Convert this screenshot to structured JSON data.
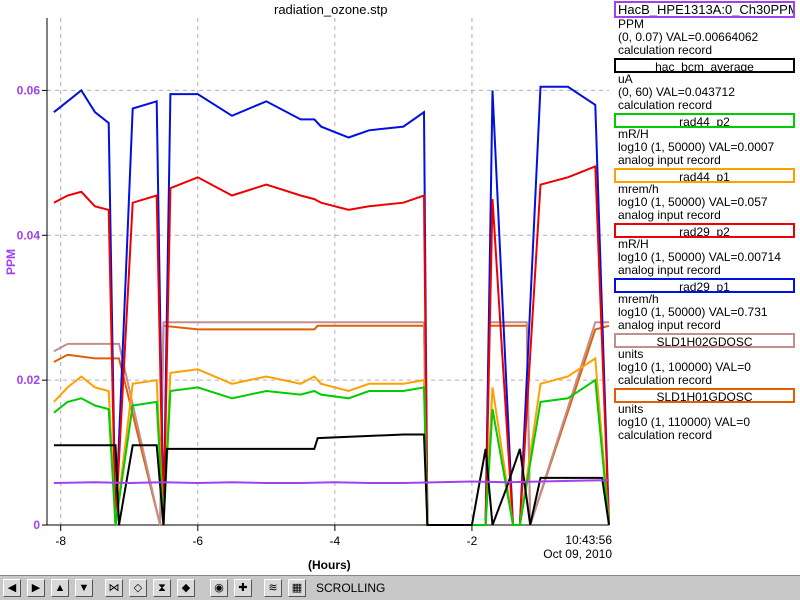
{
  "window": {
    "title": "radiation_ozone.stp",
    "status": "SCROLLING"
  },
  "chart_data": {
    "type": "line",
    "title": "radiation_ozone.stp",
    "xlabel": "(Hours)",
    "ylabel": "PPM",
    "xlim": [
      -8.2,
      0.0
    ],
    "ylim": [
      0.0,
      0.07
    ],
    "xticks": [
      -8,
      -6,
      -4,
      -2
    ],
    "yticks": [
      0,
      0.02,
      0.04,
      0.06
    ],
    "xtick_labels": [
      "-8",
      "-6",
      "-4",
      "-2"
    ],
    "ytick_labels": [
      "0",
      "0.02",
      "0.04",
      "0.06"
    ],
    "grid": true,
    "legend_position": "right",
    "time_label": "10:43:56",
    "date_label": "Oct 09, 2010",
    "series": [
      {
        "name": "HacB_HPE1313A:0_Ch30PPM",
        "color": "#a040f0",
        "x": [
          -8.1,
          -7.5,
          -7.0,
          -6.5,
          -6.0,
          -5.5,
          -5.0,
          -4.5,
          -4.0,
          -3.5,
          -3.0,
          -2.5,
          -2.0,
          -1.5,
          -1.0,
          -0.5,
          0.0
        ],
        "y": [
          0.0058,
          0.0059,
          0.0058,
          0.0059,
          0.0058,
          0.0059,
          0.0058,
          0.0058,
          0.0059,
          0.0058,
          0.0058,
          0.0059,
          0.006,
          0.0059,
          0.006,
          0.0061,
          0.0062
        ]
      },
      {
        "name": "hac_bcm_average",
        "color": "#000000",
        "x": [
          -8.1,
          -8.05,
          -7.2,
          -7.15,
          -6.95,
          -6.6,
          -6.5,
          -6.45,
          -5.5,
          -5.0,
          -4.3,
          -4.25,
          -3.0,
          -2.7,
          -2.65,
          -2.0,
          -1.8,
          -1.7,
          -1.5,
          -1.3,
          -1.15,
          -1.0,
          -0.5,
          -0.1,
          0.0
        ],
        "y": [
          0.011,
          0.011,
          0.011,
          0.0,
          0.011,
          0.011,
          0.0,
          0.0105,
          0.0105,
          0.0105,
          0.0105,
          0.012,
          0.0125,
          0.0125,
          0.0,
          0.0,
          0.0105,
          0.0,
          0.005,
          0.0105,
          0.0,
          0.0065,
          0.0065,
          0.0065,
          0.0
        ]
      },
      {
        "name": "rad44_p2",
        "color": "#00cc00",
        "x": [
          -8.1,
          -7.9,
          -7.7,
          -7.5,
          -7.3,
          -7.2,
          -6.95,
          -6.6,
          -6.5,
          -6.4,
          -6.0,
          -5.5,
          -5.0,
          -4.5,
          -4.3,
          -4.2,
          -3.8,
          -3.5,
          -3.0,
          -2.7,
          -2.65,
          -1.8,
          -1.7,
          -1.4,
          -1.3,
          -1.0,
          -0.6,
          -0.2,
          0.0
        ],
        "y": [
          0.0155,
          0.017,
          0.0175,
          0.0165,
          0.016,
          0.0,
          0.0165,
          0.017,
          0.0,
          0.0185,
          0.019,
          0.0175,
          0.0185,
          0.018,
          0.0185,
          0.018,
          0.0175,
          0.0185,
          0.0185,
          0.019,
          0.0,
          0.0,
          0.016,
          0.0,
          0.0,
          0.017,
          0.0175,
          0.02,
          0.0
        ]
      },
      {
        "name": "rad44_p1",
        "color": "#ffa000",
        "x": [
          -8.1,
          -7.9,
          -7.7,
          -7.5,
          -7.3,
          -7.2,
          -6.95,
          -6.6,
          -6.5,
          -6.4,
          -6.0,
          -5.5,
          -5.0,
          -4.5,
          -4.3,
          -4.2,
          -3.8,
          -3.5,
          -3.0,
          -2.7,
          -2.65,
          -1.8,
          -1.7,
          -1.4,
          -1.3,
          -1.0,
          -0.6,
          -0.2,
          0.0
        ],
        "y": [
          0.017,
          0.019,
          0.0205,
          0.019,
          0.0185,
          0.0,
          0.0195,
          0.02,
          0.0,
          0.021,
          0.0215,
          0.0195,
          0.0205,
          0.0195,
          0.0205,
          0.0195,
          0.0185,
          0.0195,
          0.0195,
          0.02,
          0.0,
          0.0,
          0.019,
          0.0,
          0.0,
          0.0195,
          0.0205,
          0.023,
          0.0
        ]
      },
      {
        "name": "rad29_p2",
        "color": "#ee0000",
        "x": [
          -8.1,
          -7.9,
          -7.7,
          -7.5,
          -7.3,
          -7.2,
          -6.95,
          -6.6,
          -6.5,
          -6.4,
          -6.0,
          -5.5,
          -5.0,
          -4.5,
          -4.3,
          -4.2,
          -3.8,
          -3.5,
          -3.0,
          -2.7,
          -2.65,
          -1.8,
          -1.7,
          -1.4,
          -1.3,
          -1.0,
          -0.6,
          -0.2,
          0.0
        ],
        "y": [
          0.0445,
          0.0455,
          0.046,
          0.044,
          0.0435,
          0.0,
          0.0445,
          0.0455,
          0.0,
          0.0465,
          0.048,
          0.0455,
          0.047,
          0.0455,
          0.045,
          0.0445,
          0.0435,
          0.044,
          0.0445,
          0.0455,
          0.0,
          0.0,
          0.045,
          0.0,
          0.0,
          0.047,
          0.048,
          0.0495,
          0.0
        ]
      },
      {
        "name": "rad29_p1",
        "color": "#0010e0",
        "x": [
          -8.1,
          -7.9,
          -7.7,
          -7.5,
          -7.3,
          -7.2,
          -6.95,
          -6.6,
          -6.5,
          -6.4,
          -6.0,
          -5.5,
          -5.0,
          -4.5,
          -4.3,
          -4.2,
          -3.8,
          -3.5,
          -3.0,
          -2.7,
          -2.65,
          -1.8,
          -1.7,
          -1.4,
          -1.3,
          -1.0,
          -0.6,
          -0.2,
          0.0
        ],
        "y": [
          0.057,
          0.0585,
          0.06,
          0.057,
          0.0555,
          0.0,
          0.0575,
          0.0585,
          0.0,
          0.0595,
          0.0595,
          0.0565,
          0.0585,
          0.056,
          0.056,
          0.055,
          0.0535,
          0.0545,
          0.055,
          0.057,
          0.0,
          0.0,
          0.06,
          0.0,
          0.0,
          0.0605,
          0.0605,
          0.058,
          0.0
        ]
      },
      {
        "name": "SLD1H02GDOSC",
        "color": "#c09090",
        "x": [
          -8.1,
          -7.9,
          -7.5,
          -7.15,
          -6.55,
          -6.5,
          -4.3,
          -4.25,
          -2.7,
          -2.65,
          -1.8,
          -1.75,
          -1.2,
          -1.15,
          -0.2,
          0.0
        ],
        "y": [
          0.024,
          0.025,
          0.025,
          0.025,
          0.0,
          0.028,
          0.028,
          0.028,
          0.028,
          0.0,
          0.0,
          0.028,
          0.028,
          0.0,
          0.028,
          0.028
        ]
      },
      {
        "name": "SLD1H01GDOSC",
        "color": "#e06000",
        "x": [
          -8.1,
          -7.9,
          -7.5,
          -7.15,
          -6.55,
          -6.5,
          -6.0,
          -5.5,
          -4.3,
          -4.25,
          -2.7,
          -2.65,
          -1.8,
          -1.75,
          -1.2,
          -1.15,
          -0.2,
          0.0
        ],
        "y": [
          0.0225,
          0.0235,
          0.023,
          0.023,
          0.0,
          0.0275,
          0.027,
          0.027,
          0.027,
          0.0275,
          0.0275,
          0.0,
          0.0,
          0.0275,
          0.0275,
          0.0,
          0.027,
          0.0275
        ]
      }
    ]
  },
  "legend": [
    {
      "name": "HacB_HPE1313A:0_Ch30PPM",
      "color": "#a040f0",
      "lines": [
        "PPM",
        "(0, 0.07) VAL=0.00664062",
        "calculation record"
      ]
    },
    {
      "name": "hac_bcm_average",
      "color": "#000000",
      "lines": [
        "uA",
        "(0, 60) VAL=0.043712",
        "calculation record"
      ]
    },
    {
      "name": "rad44_p2",
      "color": "#00cc00",
      "lines": [
        "mR/H",
        "log10 (1, 50000) VAL=0.0007",
        "analog input record"
      ]
    },
    {
      "name": "rad44_p1",
      "color": "#ffa000",
      "lines": [
        "mrem/h",
        "log10 (1, 50000) VAL=0.057",
        "analog input record"
      ]
    },
    {
      "name": "rad29_p2",
      "color": "#ee0000",
      "lines": [
        "mR/H",
        "log10 (1, 50000) VAL=0.00714",
        "analog input record"
      ]
    },
    {
      "name": "rad29_p1",
      "color": "#0010e0",
      "lines": [
        "mrem/h",
        "log10 (1, 50000) VAL=0.731",
        "analog input record"
      ]
    },
    {
      "name": "SLD1H02GDOSC",
      "color": "#c09090",
      "lines": [
        "units",
        "log10 (1, 100000) VAL=0",
        "calculation record"
      ]
    },
    {
      "name": "SLD1H01GDOSC",
      "color": "#e06000",
      "lines": [
        "units",
        "log10 (1, 110000) VAL=0",
        "calculation record"
      ]
    }
  ],
  "toolbar": {
    "buttons": [
      {
        "icon": "arrow-left-icon",
        "glyph": "◀"
      },
      {
        "icon": "arrow-right-icon",
        "glyph": "▶"
      },
      {
        "icon": "arrow-up-icon",
        "glyph": "▲"
      },
      {
        "icon": "arrow-down-icon",
        "glyph": "▼"
      },
      {
        "icon": "zoom-in-horizontal-icon",
        "glyph": "⋈"
      },
      {
        "icon": "zoom-out-horizontal-icon",
        "glyph": "◇"
      },
      {
        "icon": "zoom-in-vertical-icon",
        "glyph": "⧗"
      },
      {
        "icon": "zoom-out-vertical-icon",
        "glyph": "◆"
      },
      {
        "icon": "reset-zoom-icon",
        "glyph": "◉"
      },
      {
        "icon": "crosshair-icon",
        "glyph": "✚"
      },
      {
        "icon": "scroll-mode-icon",
        "glyph": "≋"
      },
      {
        "icon": "grid-toggle-icon",
        "glyph": "▦"
      }
    ]
  }
}
